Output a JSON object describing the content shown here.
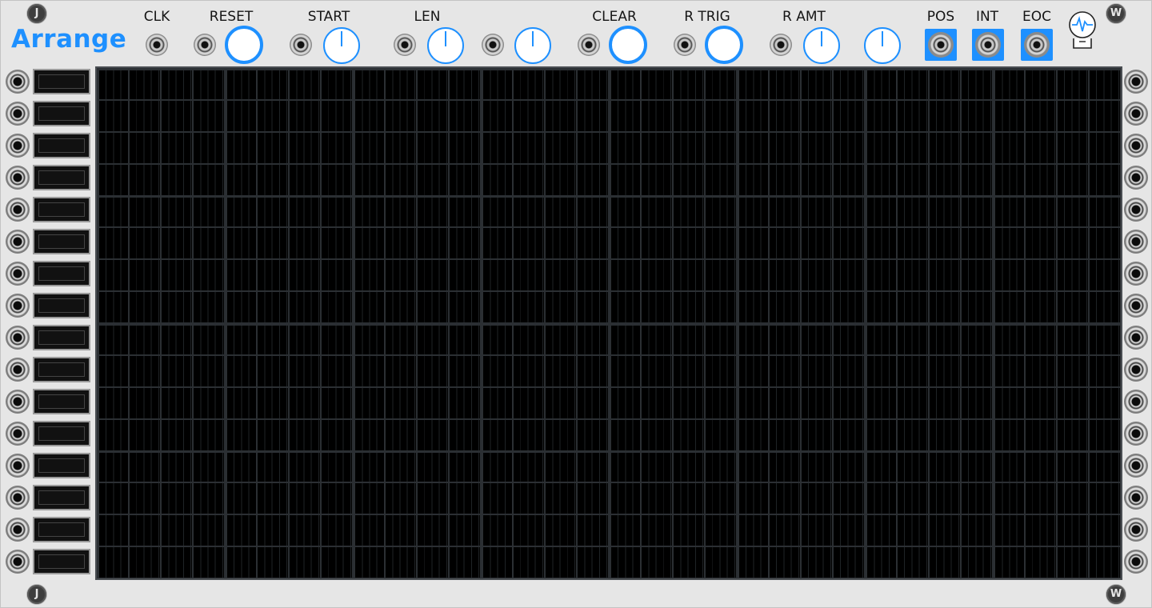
{
  "module": {
    "title": "Arrange"
  },
  "screws": {
    "left": "J",
    "right": "W"
  },
  "top_labels": {
    "clk": "CLK",
    "reset": "RESET",
    "start": "START",
    "len": "LEN",
    "clear": "CLEAR",
    "r_trig": "R TRIG",
    "r_amt": "R AMT",
    "pos": "POS",
    "int": "INT",
    "eoc": "EOC"
  },
  "grid": {
    "columns": 32,
    "rows": 16
  },
  "row_count": 16,
  "colors": {
    "accent": "#1e90ff",
    "panel": "#e6e6e6",
    "grid_bg": "#000000",
    "grid_line": "#2b2f33"
  },
  "icons": {
    "logo": "robot-face-icon",
    "jack": "jack-port-icon"
  }
}
